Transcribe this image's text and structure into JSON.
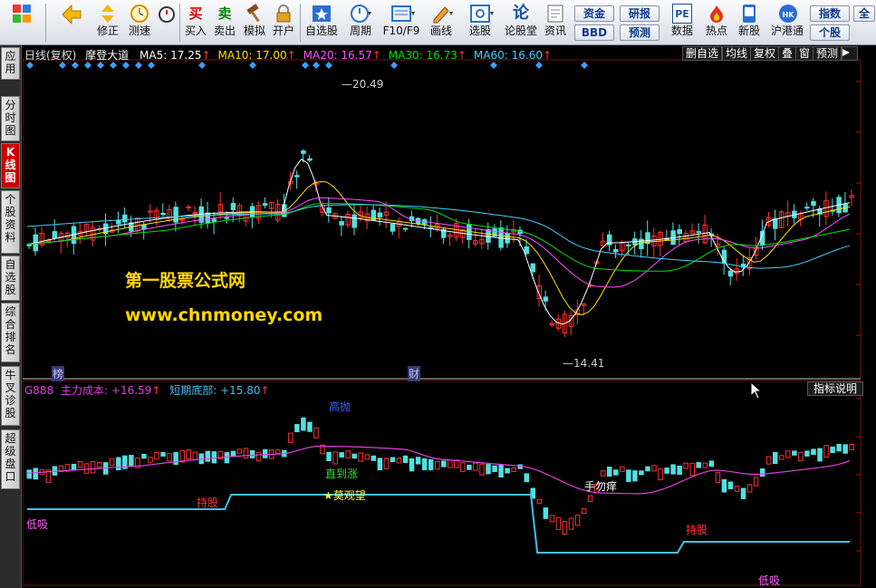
{
  "toolbar": {
    "buttons": [
      {
        "label": "",
        "icon": "app-grid-icon"
      },
      {
        "label": "",
        "icon": "back-arrow-icon"
      },
      {
        "label": "修正",
        "icon": "up-down-icon"
      },
      {
        "label": "测速",
        "icon": "clock-icon"
      },
      {
        "label": "买入",
        "icon": "buy-icon",
        "glyph": "买"
      },
      {
        "label": "卖出",
        "icon": "sell-icon",
        "glyph": "卖"
      },
      {
        "label": "模拟",
        "icon": "hammer-icon"
      },
      {
        "label": "开户",
        "icon": "lock-icon"
      },
      {
        "label": "自选股",
        "icon": "star-icon"
      },
      {
        "label": "周期",
        "icon": "period-clock-icon"
      },
      {
        "label": "F10/F9",
        "icon": "f10-icon"
      },
      {
        "label": "画线",
        "icon": "pencil-icon"
      },
      {
        "label": "选股",
        "icon": "stock-pick-icon"
      },
      {
        "label": "论股堂",
        "icon": "forum-icon",
        "glyph": "论"
      },
      {
        "label": "资讯",
        "icon": "news-icon"
      },
      {
        "label": "数据",
        "icon": "pe-icon",
        "glyph": "PE"
      },
      {
        "label": "热点",
        "icon": "hot-icon"
      },
      {
        "label": "新股",
        "icon": "new-stock-icon"
      },
      {
        "label": "沪港通",
        "icon": "hk-icon"
      }
    ],
    "small_buttons": [
      "资金",
      "BBD",
      "研报",
      "预测",
      "指数",
      "个股",
      "全"
    ]
  },
  "sidetabs": [
    "应用",
    "分时图",
    "K线图",
    "个股资料",
    "自选股",
    "综合排名",
    "牛叉诊股",
    "超级盘口"
  ],
  "chart": {
    "period_label": "日线(复权)",
    "stock_name": "摩登大道",
    "ma": [
      {
        "name": "MA5",
        "value": "17.25",
        "color": "#ffffff"
      },
      {
        "name": "MA10",
        "value": "17.00",
        "color": "#ffe000"
      },
      {
        "name": "MA20",
        "value": "16.57",
        "color": "#ff50ff"
      },
      {
        "name": "MA30",
        "value": "16.73",
        "color": "#00e000"
      },
      {
        "name": "MA60",
        "value": "16.60",
        "color": "#40d0ff"
      }
    ],
    "right_buttons": [
      "删自选",
      "均线",
      "复权",
      "叠",
      "窗",
      "预测"
    ],
    "high_label": "20.49",
    "low_label": "14.41",
    "marker_bang": "榜",
    "marker_cai": "财",
    "watermark_title": "第一股票公式网",
    "watermark_url": "www.chnmoney.com",
    "indicator": {
      "name": "G888",
      "line1": "主力成本:",
      "line1_value": "+16.59",
      "line2": "短期底部:",
      "line2_value": "+15.80",
      "button": "指标说明"
    },
    "annotations": {
      "low_buy_1": "低吸",
      "hold_1": "持股",
      "high_sell": "高抛",
      "straight_up": "直到涨",
      "wait": "★莫观望",
      "dont_itch": "手勿痒",
      "hold_2": "持股",
      "low_buy_2": "低吸"
    },
    "colors": {
      "up": "#ff3030",
      "down": "#50e0e0",
      "cost_line": "#e040e0",
      "bottom_line": "#40c0f0"
    }
  }
}
